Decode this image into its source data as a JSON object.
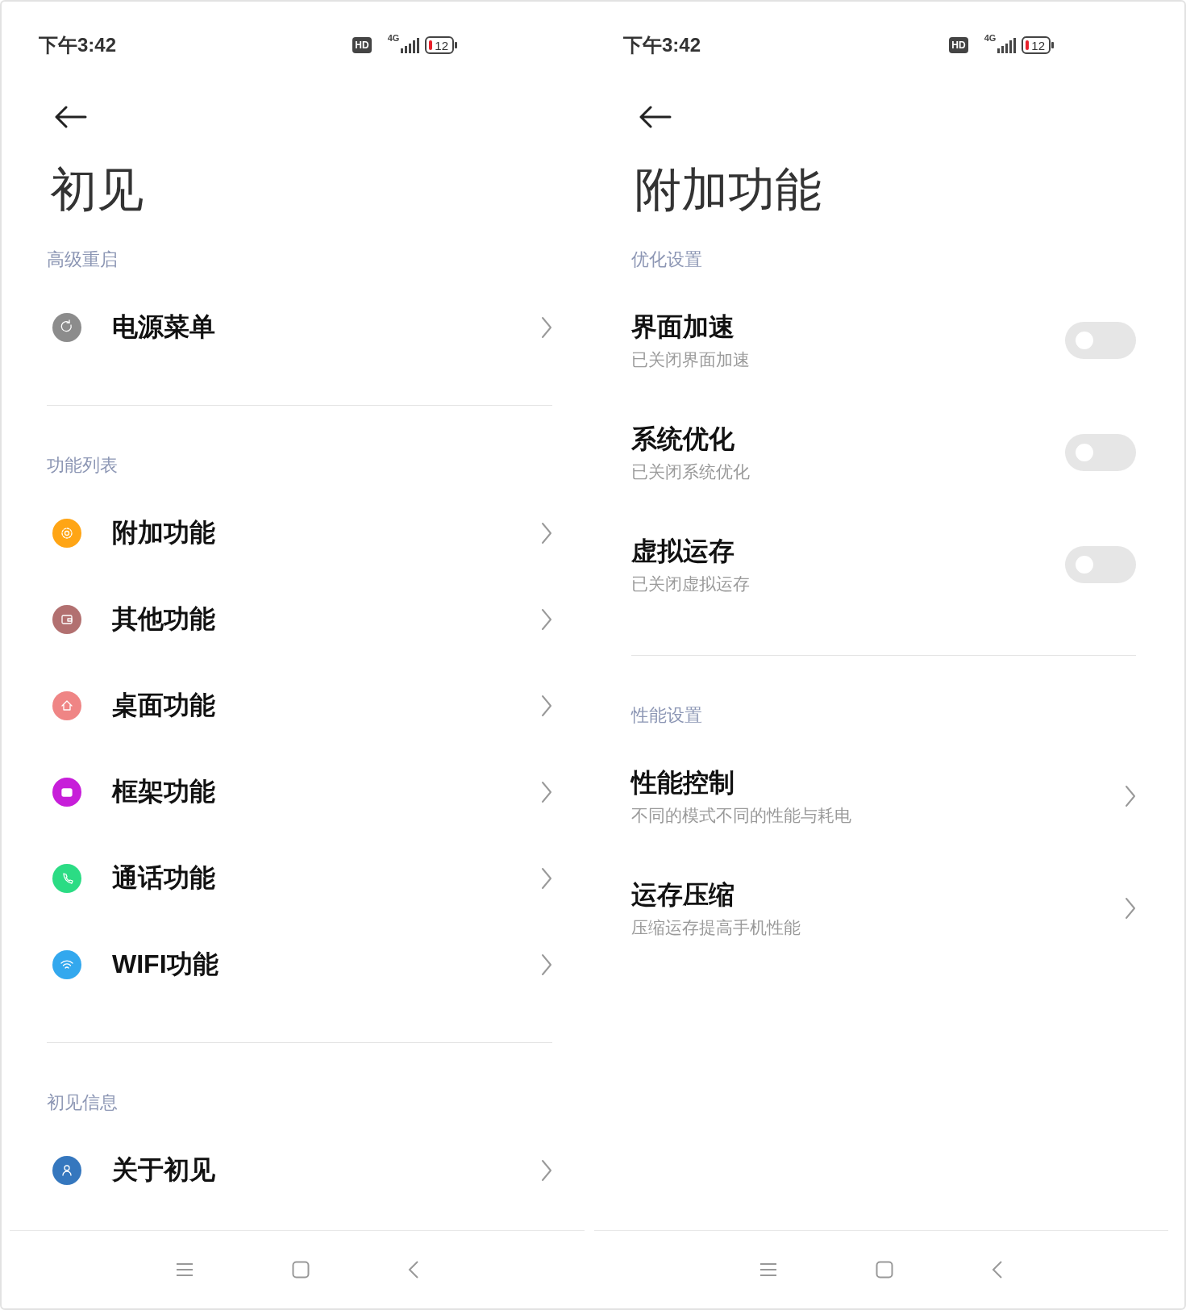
{
  "screens": [
    {
      "status_bar": {
        "time": "下午3:42",
        "hd": "HD",
        "network": "4G",
        "battery": "12"
      },
      "title": "初见",
      "sections": [
        {
          "header": "高级重启",
          "items": [
            {
              "kind": "link",
              "label": "电源菜单",
              "color": "#8c8c8c"
            }
          ]
        },
        {
          "header": "功能列表",
          "items": [
            {
              "kind": "link",
              "label": "附加功能",
              "color": "#ffa515"
            },
            {
              "kind": "link",
              "label": "其他功能",
              "color": "#b27070"
            },
            {
              "kind": "link",
              "label": "桌面功能",
              "color": "#ef8585"
            },
            {
              "kind": "link",
              "label": "框架功能",
              "color": "#c71ed9"
            },
            {
              "kind": "link",
              "label": "通话功能",
              "color": "#2bdc84"
            },
            {
              "kind": "link",
              "label": "WIFI功能",
              "color": "#33a8ee"
            }
          ]
        },
        {
          "header": "初见信息",
          "items": [
            {
              "kind": "link",
              "label": "关于初见",
              "color": "#3577be"
            }
          ]
        }
      ]
    },
    {
      "status_bar": {
        "time": "下午3:42",
        "hd": "HD",
        "network": "4G",
        "battery": "12"
      },
      "title": "附加功能",
      "sections": [
        {
          "header": "优化设置",
          "items": [
            {
              "kind": "toggle",
              "label": "界面加速",
              "subtitle": "已关闭界面加速",
              "on": false
            },
            {
              "kind": "toggle",
              "label": "系统优化",
              "subtitle": "已关闭系统优化",
              "on": false
            },
            {
              "kind": "toggle",
              "label": "虚拟运存",
              "subtitle": "已关闭虚拟运存",
              "on": false
            }
          ]
        },
        {
          "header": "性能设置",
          "items": [
            {
              "kind": "link",
              "label": "性能控制",
              "subtitle": "不同的模式不同的性能与耗电"
            },
            {
              "kind": "link",
              "label": "运存压缩",
              "subtitle": "压缩运存提高手机性能"
            }
          ]
        }
      ]
    }
  ]
}
